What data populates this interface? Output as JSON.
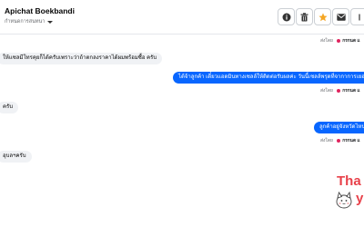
{
  "header": {
    "contact_name": "Apichat Boekbandi",
    "assignee_label": "กำหนดการสนทนา",
    "buttons": [
      {
        "name": "info",
        "icon": "info-icon"
      },
      {
        "name": "delete",
        "icon": "trash-icon"
      },
      {
        "name": "star",
        "icon": "star-icon",
        "color": "#f5a623"
      },
      {
        "name": "mail",
        "icon": "mail-icon"
      },
      {
        "name": "more",
        "icon": "more-icon"
      }
    ]
  },
  "messages": [
    {
      "direction": "in",
      "text": "ให้แซลมีโทรคุยก็ได้ครับเพราะว่าถ้าตกลงราคาได้ผมพร้อมซื้อ ครับ"
    },
    {
      "direction": "out",
      "text": "ได้จ้าลูกค้า เดี๋ยวแอดมินทางเซลล์ให้ติดต่อรับผลค่ะ วันนี้เซลล์พรุดที่จากาการเยอะ"
    },
    {
      "direction": "in",
      "text": "ครับ"
    },
    {
      "direction": "out",
      "text": "ลูกค้าอยู่จังหวัดไหน"
    },
    {
      "direction": "in",
      "text": "อุบลฯครับ"
    }
  ],
  "sent_markers": [
    {
      "by_label": "ส่งโดย",
      "agent": "กรกนด แ"
    },
    {
      "by_label": "ส่งโดย",
      "agent": "กรกนด แ"
    },
    {
      "by_label": "ส่งโดย",
      "agent": "กรกนด แ"
    }
  ],
  "sticker": {
    "text_line1": "Tha",
    "text_line2": "y",
    "color": "#e8414a"
  },
  "colors": {
    "outgoing_bubble": "#0866ff",
    "incoming_bubble": "#f0f2f5",
    "agent_dot": "#e0245e"
  }
}
